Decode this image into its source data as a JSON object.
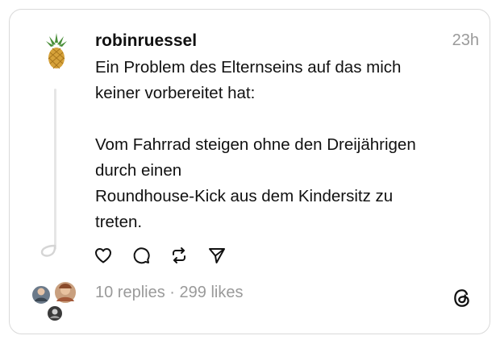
{
  "post": {
    "username": "robinruessel",
    "time": "23h",
    "lines": [
      "Ein Problem des Elternseins auf das mich",
      "keiner vorbereitet hat:",
      "",
      "Vom Fahrrad steigen ohne den Dreijährigen",
      "durch einen",
      "Roundhouse-Kick aus dem Kindersitz zu",
      "treten."
    ],
    "replies": "10 replies",
    "separator": "·",
    "likes": "299 likes"
  },
  "icons": {
    "avatar": "pineapple-avatar",
    "like": "heart-icon",
    "reply": "comment-bubble-icon",
    "repost": "repost-icon",
    "share": "send-icon",
    "brand": "threads-logo-icon"
  },
  "colors": {
    "border": "#d9d9d9",
    "muted": "#9a9a9a",
    "text": "#111111"
  }
}
